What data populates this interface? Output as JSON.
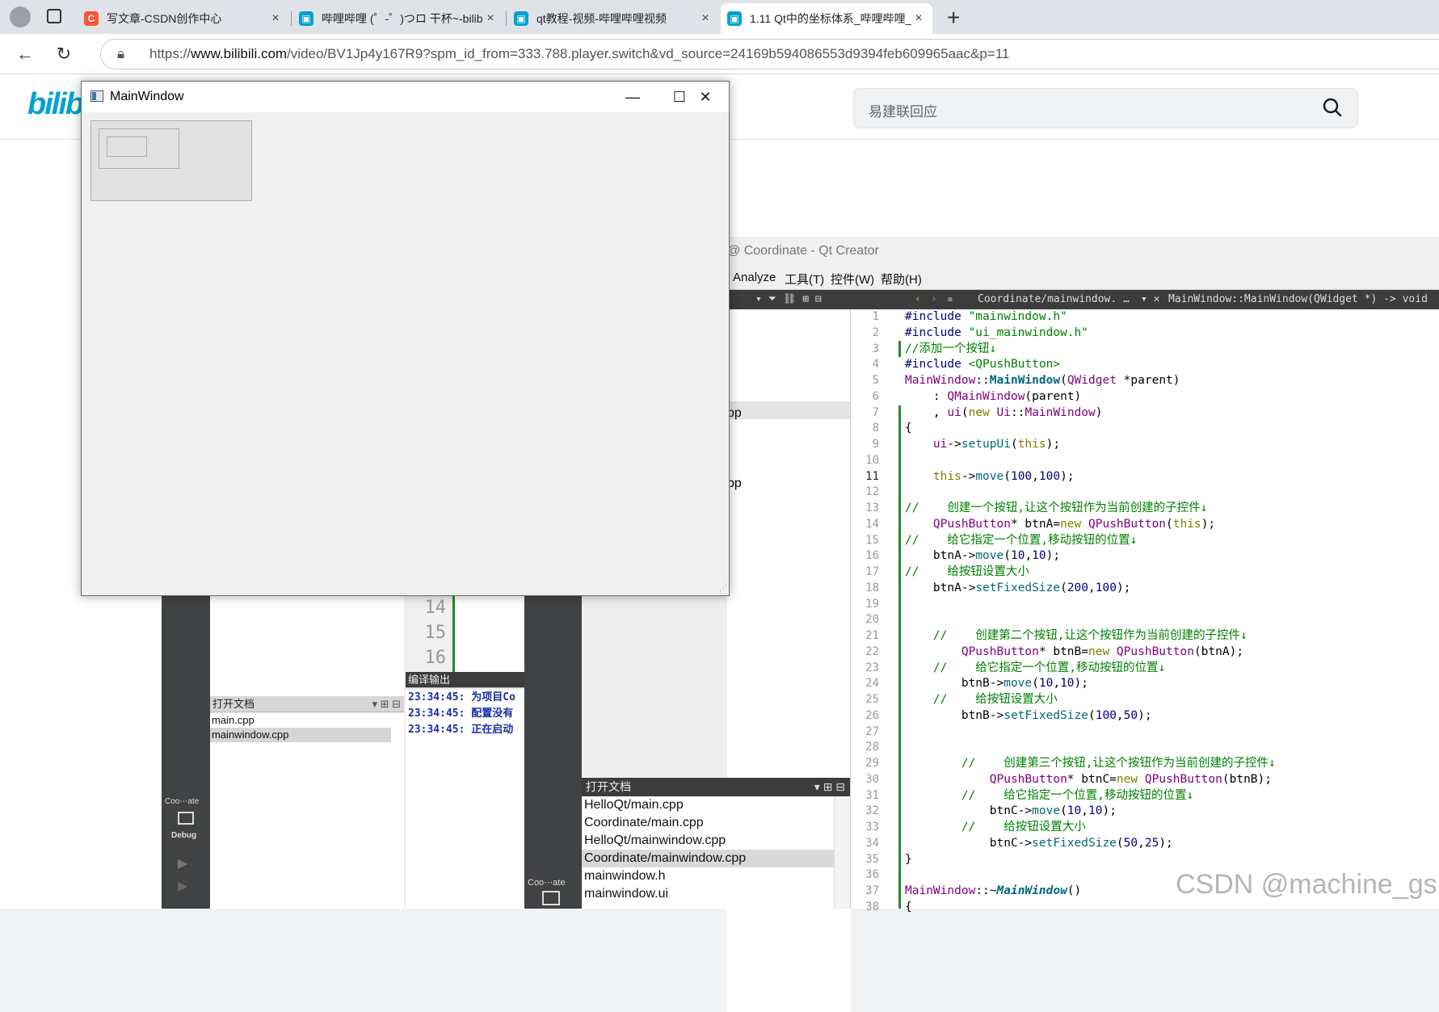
{
  "browser": {
    "tabs": [
      {
        "title": "写文章-CSDN创作中心",
        "icon": "csdn-icon",
        "active": false
      },
      {
        "title": "哔哩哔哩 (゜-゜)つロ 干杯~-bilibi",
        "icon": "bilibili-tv-icon",
        "active": false
      },
      {
        "title": "qt教程-视频-哔哩哔哩视频",
        "icon": "bilibili-tv-icon",
        "active": false
      },
      {
        "title": "1.11 Qt中的坐标体系_哔哩哔哩_bi",
        "icon": "bilibili-tv-icon",
        "active": true
      }
    ],
    "new_tab": "+",
    "close_glyph": "×",
    "url_prefix": "https://",
    "url_domain": "www.bilibili.com",
    "url_rest": "/video/BV1Jp4y167R9?spm_id_from=333.788.player.switch&vd_source=24169b594086553d9394feb609965aac&p=11"
  },
  "bilibili": {
    "logo": "bilibili",
    "search_placeholder": "易建联回应"
  },
  "qt_creator": {
    "title": "@ Coordinate - Qt Creator",
    "menu": [
      "Analyze",
      "工具(T)",
      "控件(W)",
      "帮助(H)"
    ],
    "editor_file": "Coordinate/mainwindow. …",
    "editor_symbol": "MainWindow::MainWindow(QWidget *) -> void",
    "left_pane_fragments": [
      "pp",
      "i"
    ],
    "old_line_numbers": [
      "14",
      "15",
      "16"
    ],
    "open_docs_small": {
      "title": "打开文档",
      "items": [
        "main.cpp",
        "mainwindow.cpp"
      ],
      "selected": 1
    },
    "compile_output": {
      "title": "编译输出",
      "lines": [
        "23:34:45: 为项目Co",
        "23:34:45: 配置没有",
        "23:34:45: 正在启动"
      ]
    },
    "sidebar_small": {
      "project": "Coo⋯ate",
      "mode": "Debug"
    },
    "sidebar_small2": {
      "project": "Coo⋯ate"
    },
    "open_docs_large": {
      "title": "打开文档",
      "items": [
        "HelloQt/main.cpp",
        "Coordinate/main.cpp",
        "HelloQt/mainwindow.cpp",
        "Coordinate/mainwindow.cpp",
        "mainwindow.h",
        "mainwindow.ui"
      ],
      "selected": 3
    },
    "line_numbers": [
      "1",
      "2",
      "3",
      "4",
      "5",
      "6",
      "7",
      "8",
      "9",
      "10",
      "11",
      "12",
      "13",
      "14",
      "15",
      "16",
      "17",
      "18",
      "19",
      "20",
      "21",
      "22",
      "23",
      "24",
      "25",
      "26",
      "27",
      "28",
      "29",
      "30",
      "31",
      "32",
      "33",
      "34",
      "35",
      "36",
      "37",
      "38"
    ],
    "current_line": "11"
  },
  "main_window": {
    "title": "MainWindow",
    "minimize": "—",
    "maximize": "☐",
    "close": "✕"
  },
  "watermark": "CSDN @machine_gsr"
}
